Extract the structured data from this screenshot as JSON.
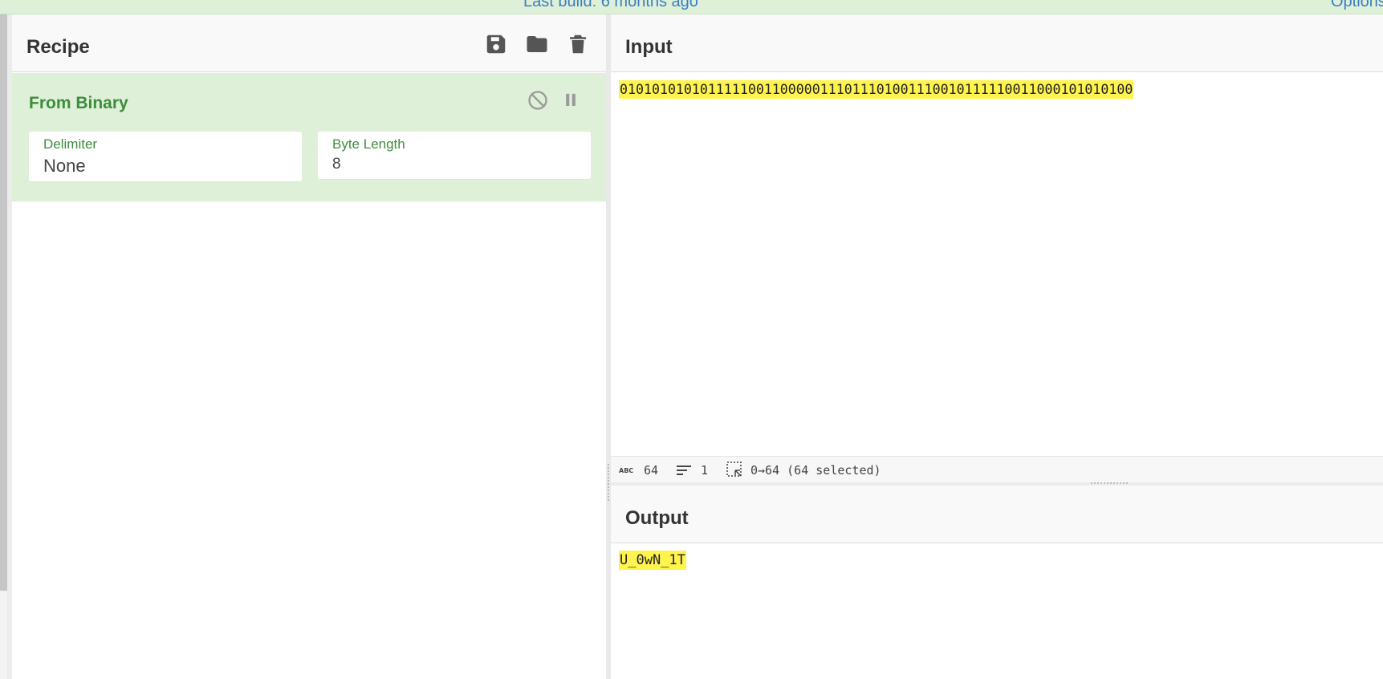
{
  "topbar": {
    "build_label": "Last build: 6 months ago",
    "options_label": "Options"
  },
  "recipe": {
    "title": "Recipe",
    "icons": [
      "save-icon",
      "folder-icon",
      "trash-icon"
    ],
    "operation": {
      "name": "From Binary",
      "fields": [
        {
          "label": "Delimiter",
          "value": "None"
        },
        {
          "label": "Byte Length",
          "value": "8"
        }
      ]
    }
  },
  "input": {
    "title": "Input",
    "text": "0101010101011111001100000111011101001110010111110011000101010100",
    "status": {
      "length": "64",
      "lines": "1",
      "selection": "0→64 (64 selected)"
    }
  },
  "output": {
    "title": "Output",
    "text": "U_0wN_1T"
  },
  "colors": {
    "op_background": "#dff0d8",
    "op_text": "#3c8d3c",
    "highlight": "#fff34d",
    "link": "#3a7ec2"
  }
}
